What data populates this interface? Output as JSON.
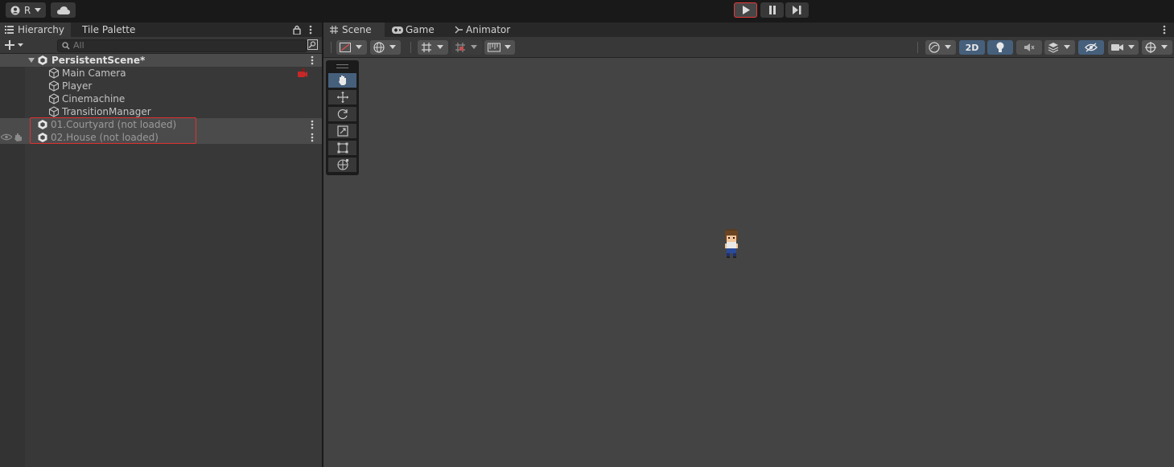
{
  "toolbar": {
    "account_label": "R",
    "play_label": "Play",
    "pause_label": "Pause",
    "step_label": "Step"
  },
  "hierarchy": {
    "tabs": [
      "Hierarchy",
      "Tile Palette"
    ],
    "search_placeholder": "All",
    "items": [
      {
        "label": "PersistentScene*",
        "type": "scene"
      },
      {
        "label": "Main Camera",
        "type": "object"
      },
      {
        "label": "Player",
        "type": "object"
      },
      {
        "label": "Cinemachine",
        "type": "object"
      },
      {
        "label": "TransitionManager",
        "type": "object"
      },
      {
        "label": "01.Courtyard (not loaded)",
        "type": "scene-unloaded"
      },
      {
        "label": "02.House (not loaded)",
        "type": "scene-unloaded"
      }
    ]
  },
  "scene_view": {
    "tabs": [
      "Scene",
      "Game",
      "Animator"
    ],
    "mode_2d_label": "2D",
    "tools": [
      "hand-tool",
      "move-tool",
      "rotate-tool",
      "scale-tool",
      "rect-tool",
      "transform-tool"
    ]
  },
  "colors": {
    "accent": "#46607c",
    "highlight_border": "#e03030"
  }
}
